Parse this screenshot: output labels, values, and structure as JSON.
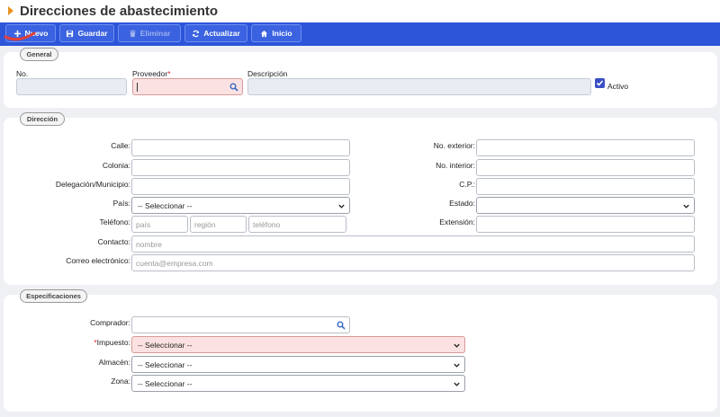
{
  "header": {
    "title": "Direcciones de abastecimiento"
  },
  "toolbar": {
    "nuevo": "Nuevo",
    "guardar": "Guardar",
    "eliminar": "Eliminar",
    "actualizar": "Actualizar",
    "inicio": "Inicio"
  },
  "general": {
    "tag": "General",
    "no_label": "No.",
    "proveedor_label": "Proveedor",
    "required_mark": "*",
    "descripcion_label": "Descripción",
    "activo_label": "Activo"
  },
  "direccion": {
    "tag": "Dirección",
    "calle": "Calle:",
    "colonia": "Colonia:",
    "delegacion": "Delegación/Municipio:",
    "pais": "País:",
    "pais_value": "-- Seleccionar --",
    "telefono": "Teléfono:",
    "tel_pais_ph": "país",
    "tel_region_ph": "región",
    "tel_numero_ph": "teléfono",
    "contacto": "Contacto:",
    "contacto_ph": "nombre",
    "correo": "Correo electrónico:",
    "correo_ph": "cuenta@empresa.com",
    "no_exterior": "No. exterior:",
    "no_interior": "No. interior:",
    "cp": "C.P.:",
    "estado": "Estado:",
    "estado_value": "",
    "extension": "Extensión:"
  },
  "especificaciones": {
    "tag": "Especificaciones",
    "comprador": "Comprador:",
    "impuesto": "Impuesto:",
    "impuesto_value": "-- Seleccionar --",
    "almacen": "Almacén:",
    "almacen_value": "-- Seleccionar --",
    "zona": "Zona:",
    "zona_value": "-- Seleccionar --",
    "required_mark": "*"
  },
  "icons": {
    "plus": "plus-icon",
    "save": "floppy-disk-icon",
    "trash": "trash-icon",
    "refresh": "refresh-icon",
    "home": "home-icon",
    "search": "search-icon",
    "chevron": "chevron-down-icon",
    "check": "check-icon"
  },
  "colors": {
    "toolbar": "#2d55d9",
    "accent": "#e8931f",
    "error_bg": "#fbe1e1"
  }
}
